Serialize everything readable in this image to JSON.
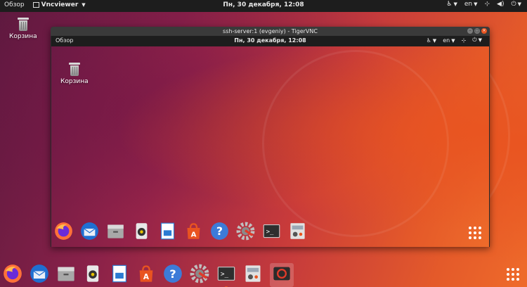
{
  "topbar": {
    "activities": "Обзор",
    "app_menu": "Vncviewer",
    "clock": "Пн, 30 декабря, 12:08",
    "lang": "en"
  },
  "desktop": {
    "trash_label": "Корзина"
  },
  "window": {
    "title": "ssh-server:1 (evgeniy) - TigerVNC"
  },
  "remote": {
    "activities": "Обзор",
    "clock": "Пн, 30 декабря, 12:08",
    "lang": "en",
    "trash_label": "Корзина"
  },
  "dock_apps": [
    "firefox-icon",
    "thunderbird-icon",
    "files-icon",
    "rhythmbox-icon",
    "libreoffice-writer-icon",
    "ubuntu-software-icon",
    "help-icon",
    "settings-icon",
    "terminal-icon",
    "system-monitor-icon"
  ],
  "colors": {
    "accent": "#e95420",
    "panel": "#1d1d1d"
  }
}
